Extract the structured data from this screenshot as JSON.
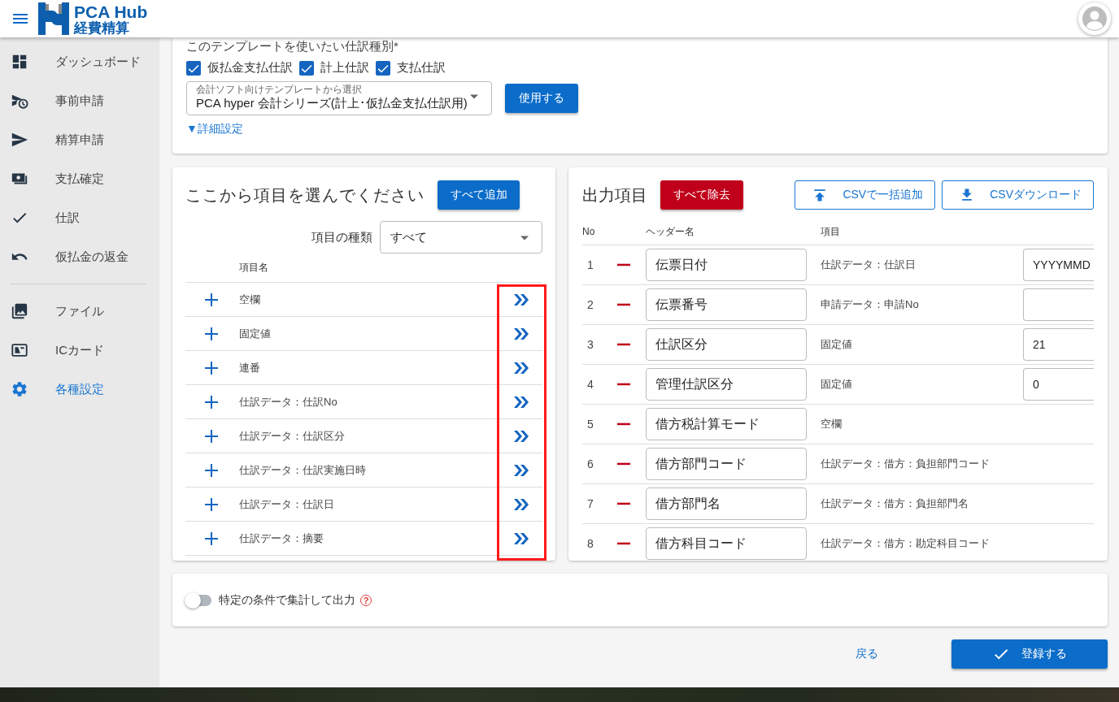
{
  "header": {
    "logo_title": "PCA Hub",
    "logo_subtitle": "経費精算"
  },
  "sidebar": {
    "sections": [
      [
        {
          "label": "ダッシュボード",
          "selected": false
        },
        {
          "label": "事前申請",
          "selected": false
        },
        {
          "label": "精算申請",
          "selected": false
        },
        {
          "label": "支払確定",
          "selected": false
        },
        {
          "label": "仕訳",
          "selected": false
        },
        {
          "label": "仮払金の返金",
          "selected": false
        }
      ],
      [
        {
          "label": "ファイル",
          "selected": false
        },
        {
          "label": "ICカード",
          "selected": false
        },
        {
          "label": "各種設定",
          "selected": true
        }
      ]
    ]
  },
  "template_card": {
    "label": "このテンプレートを使いたい仕訳種別*",
    "journal_types": [
      {
        "label": "仮払金支払仕訳",
        "checked": true
      },
      {
        "label": "計上仕訳",
        "checked": true
      },
      {
        "label": "支払仕訳",
        "checked": true
      }
    ],
    "template_select": {
      "label": "会計ソフト向けテンプレートから選択",
      "value": "PCA hyper 会計シリーズ(計上･仮払金支払仕訳用)"
    },
    "use_button": "使用する",
    "details_link": "▼詳細設定"
  },
  "item_picker": {
    "title": "ここから項目を選んでください",
    "add_all_button": "すべて追加",
    "filter": {
      "label": "項目の種類",
      "value": "すべて"
    },
    "column_header": "項目名",
    "items": [
      "空欄",
      "固定値",
      "連番",
      "仕訳データ：仕訳No",
      "仕訳データ：仕訳区分",
      "仕訳データ：仕訳実施日時",
      "仕訳データ：仕訳日",
      "仕訳データ：摘要"
    ]
  },
  "output_items": {
    "title": "出力項目",
    "remove_all_button": "すべて除去",
    "csv_import_button": "CSVで一括追加",
    "csv_download_button": "CSVダウンロード",
    "columns": [
      "No",
      "ヘッダー名",
      "項目"
    ],
    "rows": [
      {
        "no": "1",
        "header": "伝票日付",
        "item": "仕訳データ：仕訳日",
        "kind": "value_field",
        "value": "YYYYMMD"
      },
      {
        "no": "2",
        "header": "伝票番号",
        "item": "申請データ：申請No",
        "kind": "value_field"
      },
      {
        "no": "3",
        "header": "仕訳区分",
        "item": "固定値",
        "kind": "value_field",
        "value": "21"
      },
      {
        "no": "4",
        "header": "管理仕訳区分",
        "item": "固定値",
        "kind": "value_field",
        "value": "0"
      },
      {
        "no": "5",
        "header": "借方税計算モード",
        "item": "空欄",
        "kind": "plain"
      },
      {
        "no": "6",
        "header": "借方部門コード",
        "item": "仕訳データ：借方：負担部門コード",
        "kind": "plain"
      },
      {
        "no": "7",
        "header": "借方部門名",
        "item": "仕訳データ：借方：負担部門名",
        "kind": "plain"
      },
      {
        "no": "8",
        "header": "借方科目コード",
        "item": "仕訳データ：借方：勘定科目コード",
        "kind": "plain"
      }
    ]
  },
  "aggregate": {
    "label": "特定の条件で集計して出力",
    "on": false,
    "help_icon": "?"
  },
  "footer": {
    "back_link": "戻る",
    "submit_button": "登録する"
  }
}
